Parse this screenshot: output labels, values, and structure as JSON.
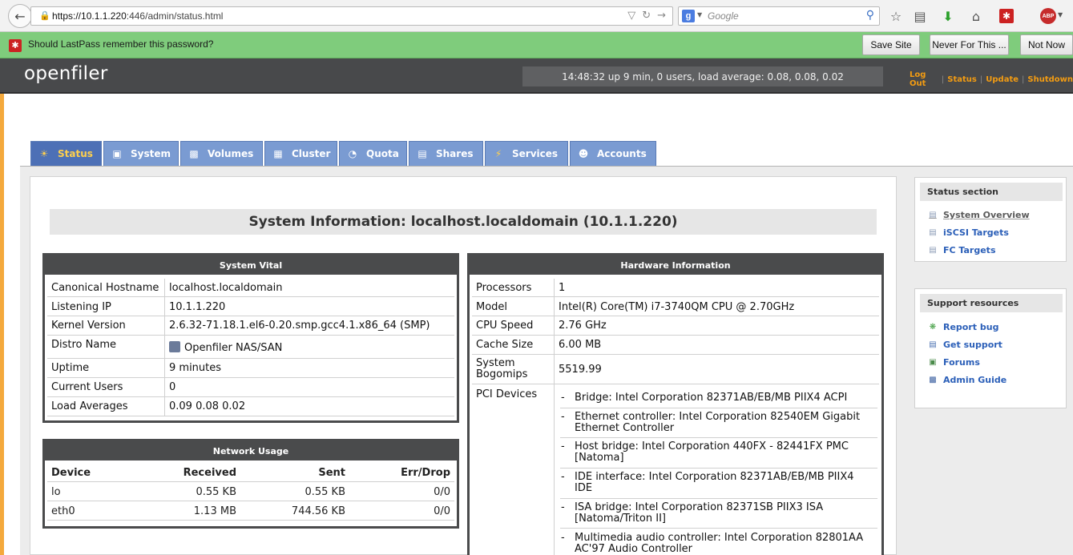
{
  "browser": {
    "url_host": "https://10.1.1.220",
    "url_rest": ":446/admin/status.html",
    "search_placeholder": "Google",
    "search_engine_letter": "g"
  },
  "lastpass": {
    "message": "Should LastPass remember this password?",
    "save_site": "Save Site",
    "never_for_this": "Never For This ...",
    "not_now": "Not Now"
  },
  "header": {
    "logo": "openfiler",
    "uptime": "14:48:32 up 9 min, 0 users, load average: 0.08, 0.08, 0.02",
    "links": [
      "Log Out",
      "Status",
      "Update",
      "Shutdown"
    ]
  },
  "tabs": [
    {
      "label": "Status",
      "active": true
    },
    {
      "label": "System"
    },
    {
      "label": "Volumes"
    },
    {
      "label": "Cluster"
    },
    {
      "label": "Quota"
    },
    {
      "label": "Shares"
    },
    {
      "label": "Services"
    },
    {
      "label": "Accounts"
    }
  ],
  "page_title": "System Information: localhost.localdomain (10.1.1.220)",
  "system_vital": {
    "title": "System Vital",
    "rows": [
      {
        "label": "Canonical Hostname",
        "value": "localhost.localdomain"
      },
      {
        "label": "Listening IP",
        "value": "10.1.1.220"
      },
      {
        "label": "Kernel Version",
        "value": "2.6.32-71.18.1.el6-0.20.smp.gcc4.1.x86_64 (SMP)"
      },
      {
        "label": "Distro Name",
        "value": "Openfiler NAS/SAN"
      },
      {
        "label": "Uptime",
        "value": "9 minutes"
      },
      {
        "label": "Current Users",
        "value": "0"
      },
      {
        "label": "Load Averages",
        "value": "0.09 0.08 0.02"
      }
    ]
  },
  "network_usage": {
    "title": "Network Usage",
    "headers": [
      "Device",
      "Received",
      "Sent",
      "Err/Drop"
    ],
    "rows": [
      {
        "device": "lo",
        "received": "0.55 KB",
        "sent": "0.55 KB",
        "errdrop": "0/0"
      },
      {
        "device": "eth0",
        "received": "1.13 MB",
        "sent": "744.56 KB",
        "errdrop": "0/0"
      }
    ]
  },
  "hardware": {
    "title": "Hardware Information",
    "rows": [
      {
        "label": "Processors",
        "value": "1"
      },
      {
        "label": "Model",
        "value": "Intel(R) Core(TM) i7-3740QM CPU @ 2.70GHz"
      },
      {
        "label": "CPU Speed",
        "value": "2.76 GHz"
      },
      {
        "label": "Cache Size",
        "value": "6.00 MB"
      },
      {
        "label": "System Bogomips",
        "value": "5519.99"
      }
    ],
    "pci_label": "PCI Devices",
    "pci_devices": [
      "Bridge: Intel Corporation 82371AB/EB/MB PIIX4 ACPI",
      "Ethernet controller: Intel Corporation 82540EM Gigabit Ethernet Controller",
      "Host bridge: Intel Corporation 440FX - 82441FX PMC [Natoma]",
      "IDE interface: Intel Corporation 82371AB/EB/MB PIIX4 IDE",
      "ISA bridge: Intel Corporation 82371SB PIIX3 ISA [Natoma/Triton II]",
      "Multimedia audio controller: Intel Corporation 82801AA AC'97 Audio Controller"
    ]
  },
  "sidebar": {
    "status_section": {
      "title": "Status section",
      "items": [
        "System Overview",
        "iSCSI Targets",
        "FC Targets"
      ]
    },
    "support": {
      "title": "Support resources",
      "items": [
        "Report bug",
        "Get support",
        "Forums",
        "Admin Guide"
      ]
    }
  }
}
